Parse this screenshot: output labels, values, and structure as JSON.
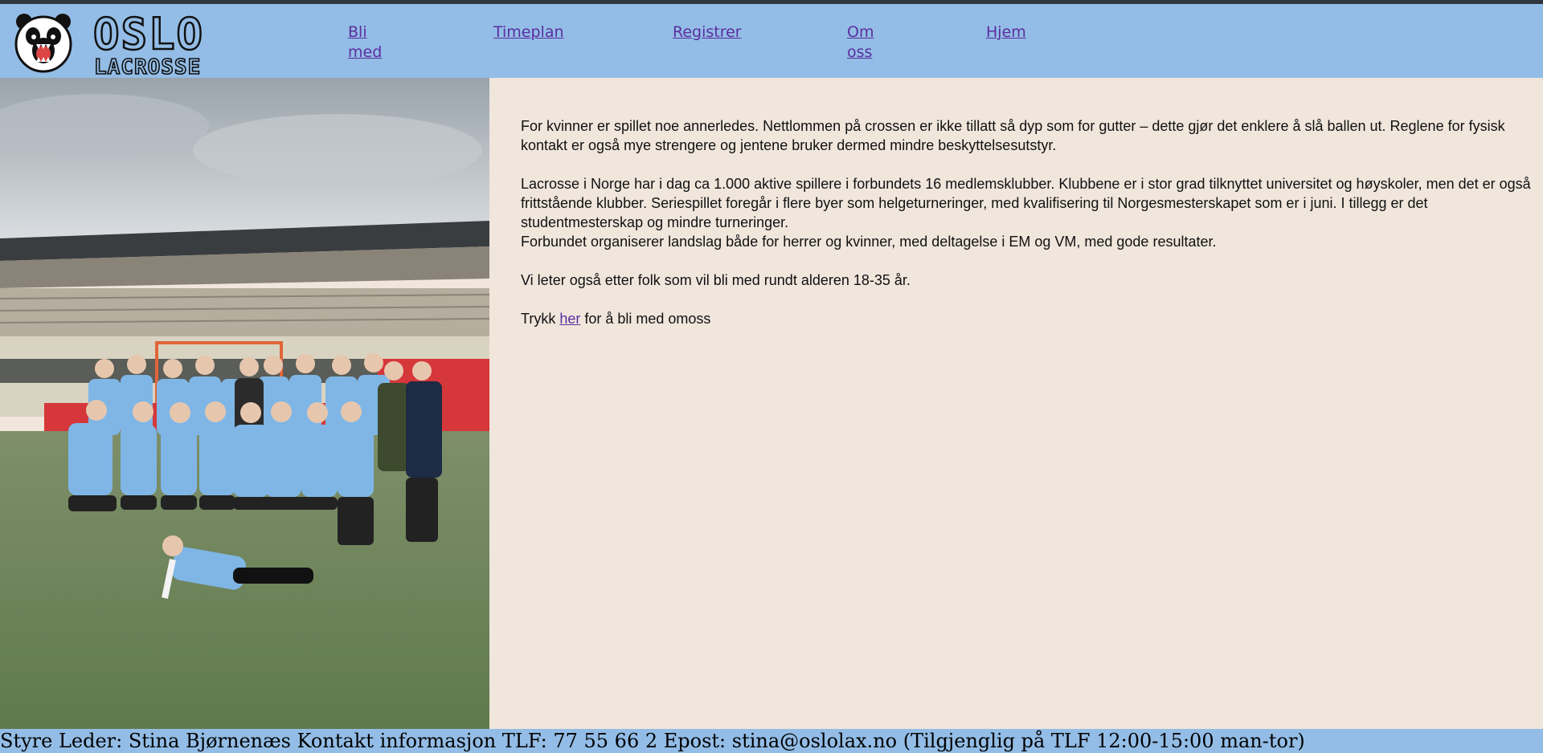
{
  "header": {
    "logo": {
      "line1": "OSLO",
      "line2": "LACROSSE"
    },
    "nav": [
      {
        "line1": "Bli",
        "line2": "med"
      },
      {
        "line1": "Timeplan",
        "line2": ""
      },
      {
        "line1": "Registrer",
        "line2": ""
      },
      {
        "line1": "Om",
        "line2": "oss"
      },
      {
        "line1": "Hjem",
        "line2": ""
      }
    ]
  },
  "content": {
    "p1_l1": "For kvinner er spillet noe annerledes. Nettlommen på crossen er ikke tillatt så dyp som for gutter – dette gjør det enklere å slå ballen ut. Reglene for fysisk",
    "p1_l2": "kontakt er også mye strengere og jentene bruker dermed mindre beskyttelsesutstyr.",
    "p2_l1": "Lacrosse i Norge har i dag ca 1.000 aktive spillere i forbundets 16 medlemsklubber. Klubbene er i stor grad tilknyttet universitet og høyskoler, men det er også",
    "p2_l2": "frittstående klubber. Seriespillet foregår i flere byer som helgeturneringer, med kvalifisering til Norgesmesterskapet som er i juni. I tillegg er det",
    "p2_l3": "studentmesterskap og mindre turneringer.",
    "p2_l4": "Forbundet organiserer landslag både for herrer og kvinner, med deltagelse i EM og VM, med gode resultater.",
    "p3": "Vi leter også etter folk som vil bli med rundt alderen 18-35 år.",
    "p4_before": "Trykk ",
    "p4_link": "her",
    "p4_after": " for å bli med omoss"
  },
  "footer": {
    "text": "Styre Leder: Stina Bjørnenæs Kontakt informasjon TLF: 77 55 66 2 Epost: stina@oslolax.no (Tilgjenglig på TLF 12:00-15:00 man-tor)"
  },
  "colors": {
    "header_bg": "#93bde6",
    "page_bg": "#f0e6dc",
    "link": "#5a2ea0",
    "jersey": "#7fb6e6"
  },
  "icons": {
    "logo": "panda-icon"
  }
}
